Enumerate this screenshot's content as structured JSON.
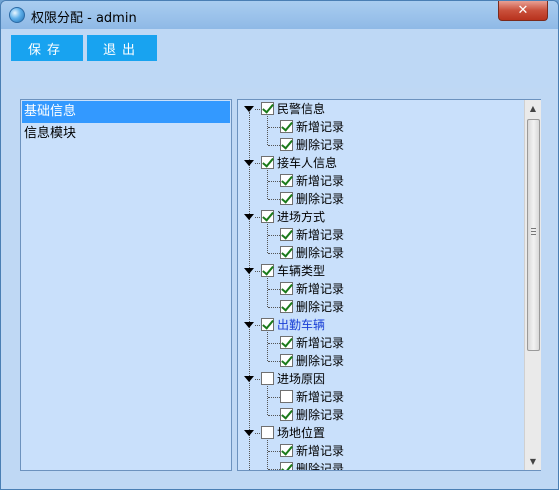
{
  "window": {
    "title": "权限分配 - admin",
    "close_glyph": "✕"
  },
  "toolbar": {
    "save_label": "保存",
    "exit_label": "退出"
  },
  "modules": [
    {
      "label": "基础信息",
      "selected": true
    },
    {
      "label": "信息模块",
      "selected": false
    }
  ],
  "tree": [
    {
      "label": "民警信息",
      "checked": true,
      "highlight": false,
      "children": [
        {
          "label": "新增记录",
          "checked": true
        },
        {
          "label": "删除记录",
          "checked": true
        }
      ]
    },
    {
      "label": "接车人信息",
      "checked": true,
      "highlight": false,
      "children": [
        {
          "label": "新增记录",
          "checked": true
        },
        {
          "label": "删除记录",
          "checked": true
        }
      ]
    },
    {
      "label": "进场方式",
      "checked": true,
      "highlight": false,
      "children": [
        {
          "label": "新增记录",
          "checked": true
        },
        {
          "label": "删除记录",
          "checked": true
        }
      ]
    },
    {
      "label": "车辆类型",
      "checked": true,
      "highlight": false,
      "children": [
        {
          "label": "新增记录",
          "checked": true
        },
        {
          "label": "删除记录",
          "checked": true
        }
      ]
    },
    {
      "label": "出勤车辆",
      "checked": true,
      "highlight": true,
      "children": [
        {
          "label": "新增记录",
          "checked": true
        },
        {
          "label": "删除记录",
          "checked": true
        }
      ]
    },
    {
      "label": "进场原因",
      "checked": false,
      "highlight": false,
      "children": [
        {
          "label": "新增记录",
          "checked": false
        },
        {
          "label": "删除记录",
          "checked": true
        }
      ]
    },
    {
      "label": "场地位置",
      "checked": false,
      "highlight": false,
      "children": [
        {
          "label": "新增记录",
          "checked": true
        },
        {
          "label": "删除记录",
          "checked": true
        }
      ]
    }
  ],
  "icons": {
    "app": "app-globe-icon",
    "expand": "triangle-down-icon",
    "scroll_up": "▲",
    "scroll_down": "▼"
  }
}
